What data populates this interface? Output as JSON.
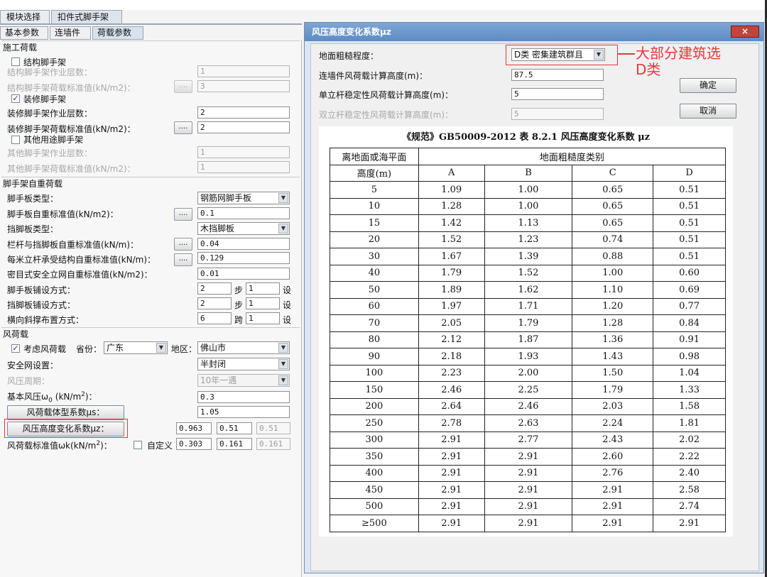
{
  "top_tabs": [
    "模块选择",
    "扣件式脚手架"
  ],
  "sub_tabs": [
    "基本参数",
    "连墙件",
    "荷载参数"
  ],
  "construction_load": {
    "section_title": "施工荷载",
    "struct_scaffold_label": "结构脚手架",
    "struct_layers_label": "结构脚手架作业层数：",
    "struct_layers_value": "1",
    "struct_load_label": "结构脚手架荷载标准值(kN/m2)：",
    "struct_load_value": "3",
    "deco_scaffold_label": "装修脚手架",
    "deco_layers_label": "装修脚手架作业层数：",
    "deco_layers_value": "2",
    "deco_load_label": "装修脚手架荷载标准值(kN/m2)：",
    "deco_load_value": "2",
    "other_scaffold_label": "其他用途脚手架",
    "other_layers_label": "其他脚手架作业层数：",
    "other_layers_value": "1",
    "other_load_label": "其他脚手架荷载标准值(kN/m2)：",
    "other_load_value": "1",
    "dots": "...."
  },
  "self_weight": {
    "section_title": "脚手架自重荷载",
    "board_type_label": "脚手板类型：",
    "board_type_value": "钢筋网脚手板",
    "board_weight_label": "脚手板自重标准值(kN/m2)：",
    "board_weight_value": "0.1",
    "toe_type_label": "挡脚板类型：",
    "toe_type_value": "木挡脚板",
    "rail_weight_label": "栏杆与挡脚板自重标准值(kN/m)：",
    "rail_weight_value": "0.04",
    "pole_weight_label": "每米立杆承受结构自重标准值(kN/m)：",
    "pole_weight_value": "0.129",
    "net_weight_label": "密目式安全立网自重标准值(kN/m2)：",
    "net_weight_value": "0.01",
    "board_lay_label": "脚手板铺设方式：",
    "board_lay_a": "2",
    "board_lay_b": "1",
    "toe_lay_label": "挡脚板铺设方式：",
    "toe_lay_a": "2",
    "toe_lay_b": "1",
    "brace_label": "横向斜撑布置方式：",
    "brace_a": "6",
    "brace_b": "1",
    "step_word": "步",
    "span_word": "跨",
    "set_word": "设"
  },
  "wind_load": {
    "section_title": "风荷载",
    "consider_label": "考虑风荷载",
    "province_label": "省份：",
    "province_value": "广东",
    "region_label": "地区：",
    "region_value": "佛山市",
    "safety_net_label": "安全网设置：",
    "safety_net_value": "半封闭",
    "period_label": "风压周期：",
    "period_value": "10年一遇",
    "basic_pressure_label": "基本风压ω",
    "basic_pressure_sub": "0",
    "basic_pressure_unit": "(kN/m",
    "basic_pressure_sup": "2",
    "basic_pressure_end": ")：",
    "basic_pressure_value": "0.3",
    "shape_coef_button": "风荷载体型系数μs：",
    "shape_coef_value": "1.05",
    "height_coef_button": "风压高度变化系数μz：",
    "height_coef_values": [
      "0.963",
      "0.51",
      "0.51"
    ],
    "std_value_label": "风荷载标准值ωk(kN/m",
    "std_value_sup": "2",
    "std_value_end": ")：",
    "custom_label": "自定义",
    "std_values": [
      "0.303",
      "0.161",
      "0.161"
    ]
  },
  "dialog": {
    "title": "风压高度变化系数μz",
    "close_label": "×",
    "roughness_label": "地面粗糙程度：",
    "roughness_value": "D类 密集建筑群且",
    "wall_height_label": "连墙件风荷载计算高度(m)：",
    "wall_height_value": "87.5",
    "single_height_label": "单立杆稳定性风荷载计算高度(m)：",
    "single_height_value": "5",
    "double_height_label": "双立杆稳定性风荷载计算高度(m)：",
    "double_height_value": "5",
    "ok_label": "确定",
    "cancel_label": "取消",
    "table_title": "《规范》GB50009-2012 表 8.2.1 风压高度变化系数 μz",
    "header_left_1": "离地面或海平面",
    "header_left_2": "高度(m)",
    "header_group": "地面粗糙度类别",
    "header_cols": [
      "A",
      "B",
      "C",
      "D"
    ],
    "rows": [
      [
        "5",
        "1.09",
        "1.00",
        "0.65",
        "0.51"
      ],
      [
        "10",
        "1.28",
        "1.00",
        "0.65",
        "0.51"
      ],
      [
        "15",
        "1.42",
        "1.13",
        "0.65",
        "0.51"
      ],
      [
        "20",
        "1.52",
        "1.23",
        "0.74",
        "0.51"
      ],
      [
        "30",
        "1.67",
        "1.39",
        "0.88",
        "0.51"
      ],
      [
        "40",
        "1.79",
        "1.52",
        "1.00",
        "0.60"
      ],
      [
        "50",
        "1.89",
        "1.62",
        "1.10",
        "0.69"
      ],
      [
        "60",
        "1.97",
        "1.71",
        "1.20",
        "0.77"
      ],
      [
        "70",
        "2.05",
        "1.79",
        "1.28",
        "0.84"
      ],
      [
        "80",
        "2.12",
        "1.87",
        "1.36",
        "0.91"
      ],
      [
        "90",
        "2.18",
        "1.93",
        "1.43",
        "0.98"
      ],
      [
        "100",
        "2.23",
        "2.00",
        "1.50",
        "1.04"
      ],
      [
        "150",
        "2.46",
        "2.25",
        "1.79",
        "1.33"
      ],
      [
        "200",
        "2.64",
        "2.46",
        "2.03",
        "1.58"
      ],
      [
        "250",
        "2.78",
        "2.63",
        "2.24",
        "1.81"
      ],
      [
        "300",
        "2.91",
        "2.77",
        "2.43",
        "2.02"
      ],
      [
        "350",
        "2.91",
        "2.91",
        "2.60",
        "2.22"
      ],
      [
        "400",
        "2.91",
        "2.91",
        "2.76",
        "2.40"
      ],
      [
        "450",
        "2.91",
        "2.91",
        "2.91",
        "2.58"
      ],
      [
        "500",
        "2.91",
        "2.91",
        "2.91",
        "2.74"
      ],
      [
        "≥500",
        "2.91",
        "2.91",
        "2.91",
        "2.91"
      ]
    ]
  },
  "annotation": {
    "line1": "大部分建筑选",
    "line2": "D类"
  },
  "colors": {
    "annotation_red": "#e23a3a",
    "dialog_title": "#5d8bc2",
    "close_button": "#c6433a"
  }
}
